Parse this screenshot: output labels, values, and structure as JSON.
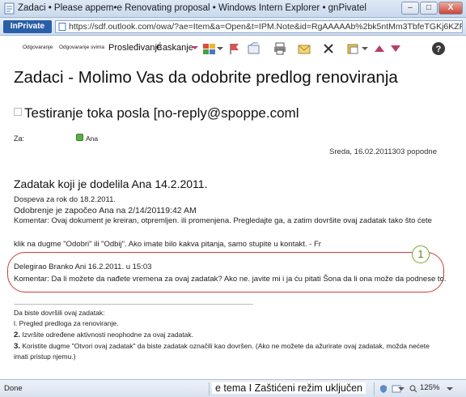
{
  "window": {
    "title": "Zadaci • Please appem•e Renovating proposal • Windows Intern Explorer • gnPivatel",
    "buttons": {
      "minimize": "–",
      "maximize": "□",
      "close": "X"
    }
  },
  "address_bar": {
    "inprivate_label": "InPrivate",
    "url": "https://sdf.outlook.com/owa/?ae=Item&a=Open&t=IPM.Note&id=RgAAAAAb%2bk5ntMm3TbfeTGKj6KZRBwDFtt1A"
  },
  "toolbar": {
    "reply_label": "Odgovaranje",
    "reply_all_label": "Odgovaranje svima",
    "forward_label": "Prosleđivanje",
    "chat_label": "Ćaskanje",
    "icons": [
      "categories-icon",
      "flag-icon",
      "move-icon",
      "print-icon",
      "unread-icon",
      "delete-icon",
      "move-to-folder-icon",
      "mail-icon",
      "help-icon"
    ]
  },
  "message": {
    "subject": "Zadaci - Molimo Vas da odobrite predlog renoviranja",
    "sender": "Testiranje toka posla [no-reply@spoppe.coml",
    "to_label": "Za:",
    "to_name": "Ana",
    "date": "Sreda, 16.02.2011303 popodne"
  },
  "body": {
    "task_title": "Zadatak koji je dodelila Ana 14.2.2011.",
    "due": "Dospeva za rok do 18.2.2011.",
    "started": "Odobrenje je započeo Ana na 2/14/20119:42 AM",
    "comment1": "Komentar: Ovaj dokument je kreiran, otpremljen. ili promenjena. Pregledajte ga, a zatim dovršite ovaj zadatak tako što ćete",
    "comment1_cont": "klik na dugme \"Odobri\" ili \"Odbij\". Ako imate bilo kakva pitanja, samo stupite u kontakt. - Fr",
    "delegated": "Delegirao Branko Ani 16.2.2011. u 15:03",
    "comment2": "Komentar: Da li možete da nađete vremena za ovaj zadatak? Ako ne. javite mi i ja ću pitati Šona da li ona može da podnese to.",
    "callout_number": "1",
    "steps_intro": "Da biste dovršili ovaj zadatak:",
    "step1": "l. Pregled predloga za renoviranje.",
    "step2_num": "2.",
    "step2": "Izvršite određene aktivnosti neophodne za ovaj zadatak.",
    "step3_num": "3.",
    "step3": "Koristite dugme \"Otvori ovaj zadatak\" da biste zadatak označili kao dovršen. (Ako ne možete da ažurirate ovaj zadatak, možda nećete",
    "step3_cont": "imati pristup njemu.)"
  },
  "status_bar": {
    "done": "Done",
    "zone": "e tema I Zaštićeni režim uključen",
    "zoom": "125%"
  }
}
